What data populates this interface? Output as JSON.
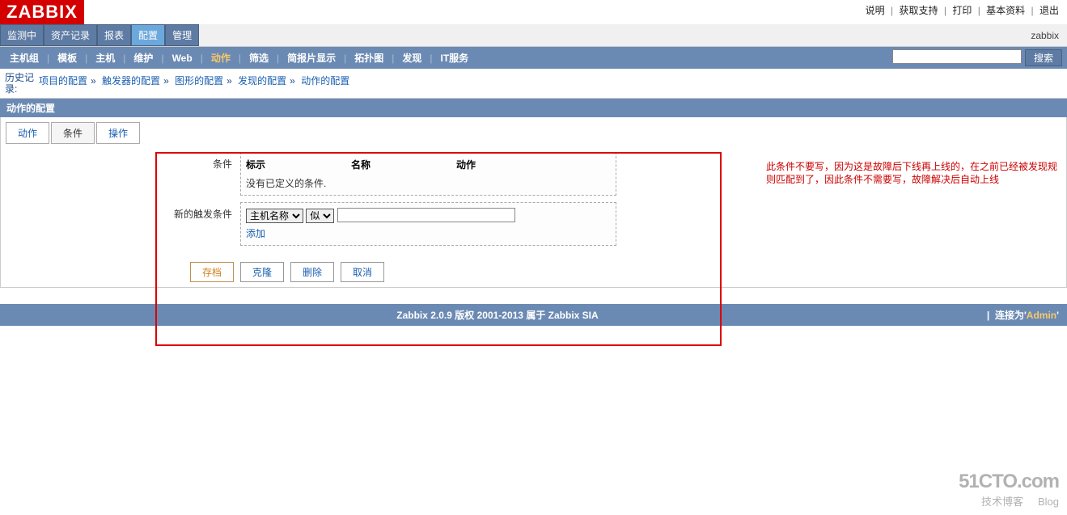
{
  "logo": "ZABBIX",
  "top_links": {
    "help": "说明",
    "support": "获取支持",
    "print": "打印",
    "profile": "基本资料",
    "logout": "退出"
  },
  "main_nav": {
    "items": [
      "监测中",
      "资产记录",
      "报表",
      "配置",
      "管理"
    ],
    "active_index": 3
  },
  "user_label": "zabbix",
  "sub_nav": {
    "items": [
      "主机组",
      "模板",
      "主机",
      "维护",
      "Web",
      "动作",
      "筛选",
      "简报片显示",
      "拓扑图",
      "发现",
      "IT服务"
    ],
    "active_index": 5
  },
  "search": {
    "placeholder": "",
    "button": "搜索"
  },
  "history": {
    "label": "历史记录:",
    "items": [
      "项目的配置",
      "触发器的配置",
      "图形的配置",
      "发现的配置",
      "动作的配置"
    ]
  },
  "section_title": "动作的配置",
  "tabs": {
    "items": [
      "动作",
      "条件",
      "操作"
    ],
    "active_index": 1
  },
  "form": {
    "condition_label": "条件",
    "cond_headers": {
      "mark": "标示",
      "name": "名称",
      "action": "动作"
    },
    "cond_empty": "没有已定义的条件.",
    "new_condition_label": "新的触发条件",
    "select_type": "主机名称",
    "select_op": "似",
    "input_value": "",
    "add_label": "添加"
  },
  "annotation": "此条件不要写，因为这是故障后下线再上线的，在之前已经被发现规则匹配到了，因此条件不需要写，故障解决后自动上线",
  "buttons": {
    "save": "存档",
    "clone": "克隆",
    "delete": "删除",
    "cancel": "取消"
  },
  "footer": {
    "center": "Zabbix 2.0.9 版权 2001-2013 属于 Zabbix SIA",
    "right_prefix": "连接为'",
    "right_user": "Admin",
    "right_suffix": "'"
  },
  "watermark": {
    "line1": "51CTO.com",
    "line2": "技术博客",
    "line2b": "Blog"
  }
}
